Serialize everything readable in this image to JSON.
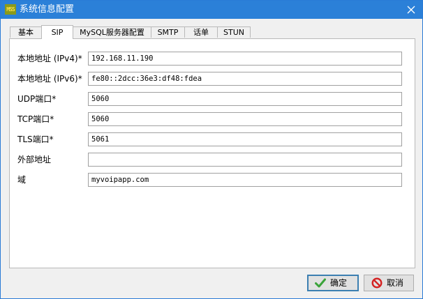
{
  "window": {
    "title": "系统信息配置",
    "app_icon_text": "MSS"
  },
  "tabs": [
    {
      "label": "基本",
      "active": false
    },
    {
      "label": "SIP",
      "active": true
    },
    {
      "label": "MySQL服务器配置",
      "active": false
    },
    {
      "label": "SMTP",
      "active": false
    },
    {
      "label": "话单",
      "active": false
    },
    {
      "label": "STUN",
      "active": false
    }
  ],
  "form": {
    "fields": [
      {
        "label": "本地地址 (IPv4)*",
        "value": "192.168.11.190"
      },
      {
        "label": "本地地址 (IPv6)*",
        "value": "fe80::2dcc:36e3:df48:fdea"
      },
      {
        "label": "UDP端口*",
        "value": "5060"
      },
      {
        "label": "TCP端口*",
        "value": "5060"
      },
      {
        "label": "TLS端口*",
        "value": "5061"
      },
      {
        "label": "外部地址",
        "value": ""
      },
      {
        "label": "域",
        "value": "myvoipapp.com"
      }
    ]
  },
  "buttons": {
    "ok_label": "确定",
    "cancel_label": "取消"
  },
  "icons": {
    "app": "app-logo-icon",
    "close": "close-icon",
    "ok": "checkmark-icon",
    "cancel": "no-entry-icon"
  },
  "colors": {
    "titlebar": "#2b80d8",
    "ok_check": "#3aa33a",
    "cancel_red": "#d42020"
  }
}
